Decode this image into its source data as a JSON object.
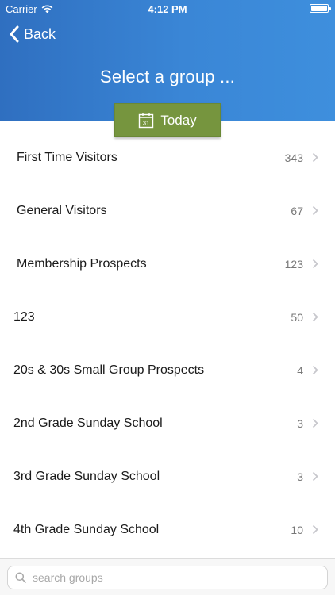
{
  "status_bar": {
    "carrier": "Carrier",
    "time": "4:12 PM"
  },
  "nav": {
    "back_label": "Back",
    "title": "Select a group ..."
  },
  "today_button": {
    "label": "Today",
    "calendar_day": "31"
  },
  "groups": [
    {
      "name": "First Time Visitors",
      "count": "343"
    },
    {
      "name": "General Visitors",
      "count": "67"
    },
    {
      "name": "Membership Prospects",
      "count": "123"
    },
    {
      "name": "123",
      "count": "50"
    },
    {
      "name": "20s & 30s Small Group Prospects",
      "count": "4"
    },
    {
      "name": "2nd Grade Sunday School",
      "count": "3"
    },
    {
      "name": "3rd Grade Sunday School",
      "count": "3"
    },
    {
      "name": "4th Grade Sunday School",
      "count": "10"
    }
  ],
  "search": {
    "placeholder": "search groups",
    "value": ""
  },
  "colors": {
    "header": "#3a86d6",
    "today": "#76953e",
    "count": "#777777",
    "chevron": "#c7c7cc"
  }
}
